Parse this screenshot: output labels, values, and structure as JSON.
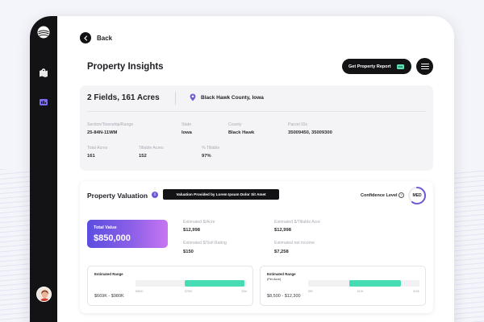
{
  "nav": {
    "back_label": "Back"
  },
  "header": {
    "title": "Property Insights",
    "report_button": "Get Property Report",
    "report_badge": "PDF"
  },
  "summary": {
    "fields_title": "2 Fields, 161 Acres",
    "county": "Black Hawk County, Iowa",
    "details": [
      {
        "label": "Section/Township/Range",
        "value": "25-84N-11WM"
      },
      {
        "label": "State",
        "value": "Iowa"
      },
      {
        "label": "County",
        "value": "Black Hawk"
      },
      {
        "label": "Parcel IDs",
        "value": "35009450, 35009300"
      },
      {
        "label": "Total Acres",
        "value": "161"
      },
      {
        "label": "Tillable Acres",
        "value": "152"
      },
      {
        "label": "% Tillable",
        "value": "97%"
      }
    ]
  },
  "valuation": {
    "title": "Property Valuation",
    "info_icon": "i",
    "tooltip": "Valuation Provided by Lorem Ipsum Dolor Sit Amet",
    "confidence_label": "Confidence Level",
    "confidence_help": "?",
    "confidence_value": "MED",
    "confidence_fraction": 0.6,
    "total_label": "Total Value",
    "total_value": "$850,000",
    "metrics": [
      {
        "label": "Estimated $/Acre",
        "value": "$12,998"
      },
      {
        "label": "Estimated $/Tillable Acre",
        "value": "$12,998"
      },
      {
        "label": "Estimated $/Soil Rating",
        "value": "$150"
      },
      {
        "label": "Estimated net income",
        "value": "$7,258"
      }
    ],
    "ranges": [
      {
        "label": "Estimated Range",
        "sub": "",
        "value": "$669K - $980K",
        "ticks": [
          "$650K",
          "$750K",
          "$1M"
        ],
        "fill_start": 0.44,
        "fill_end": 0.98
      },
      {
        "label": "Estimated Range",
        "sub": "(Per Acre)",
        "value": "$8,500 - $12,300",
        "ticks": [
          "$5K",
          "$10K",
          "$15K"
        ],
        "fill_start": 0.37,
        "fill_end": 0.83
      }
    ]
  },
  "colors": {
    "accent": "#6c5bd4",
    "range_fill": "#47dbb4",
    "dark": "#131316"
  }
}
